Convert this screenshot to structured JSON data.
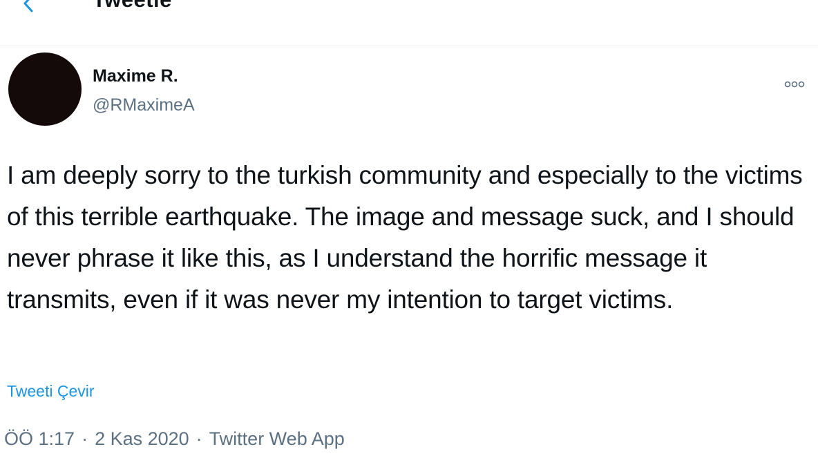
{
  "header": {
    "title": "Tweetle",
    "back_icon": "arrow-left-icon",
    "accent_color": "#1b95e0"
  },
  "tweet": {
    "author": {
      "display_name": "Maxime R.",
      "handle": "@RMaximeA",
      "avatar_color": "#140a0a"
    },
    "more_icon": "more-options-icon",
    "text": "I am deeply sorry to the turkish community and especially to the victims of this terrible earthquake. The image and message suck, and I should never phrase it like this, as I understand the horrific message it transmits, even if it was never my intention to target victims.",
    "translate_label": "Tweeti Çevir",
    "time": "ÖÖ 1:17",
    "separator": "·",
    "date": "2 Kas 2020",
    "source": "Twitter Web App"
  }
}
